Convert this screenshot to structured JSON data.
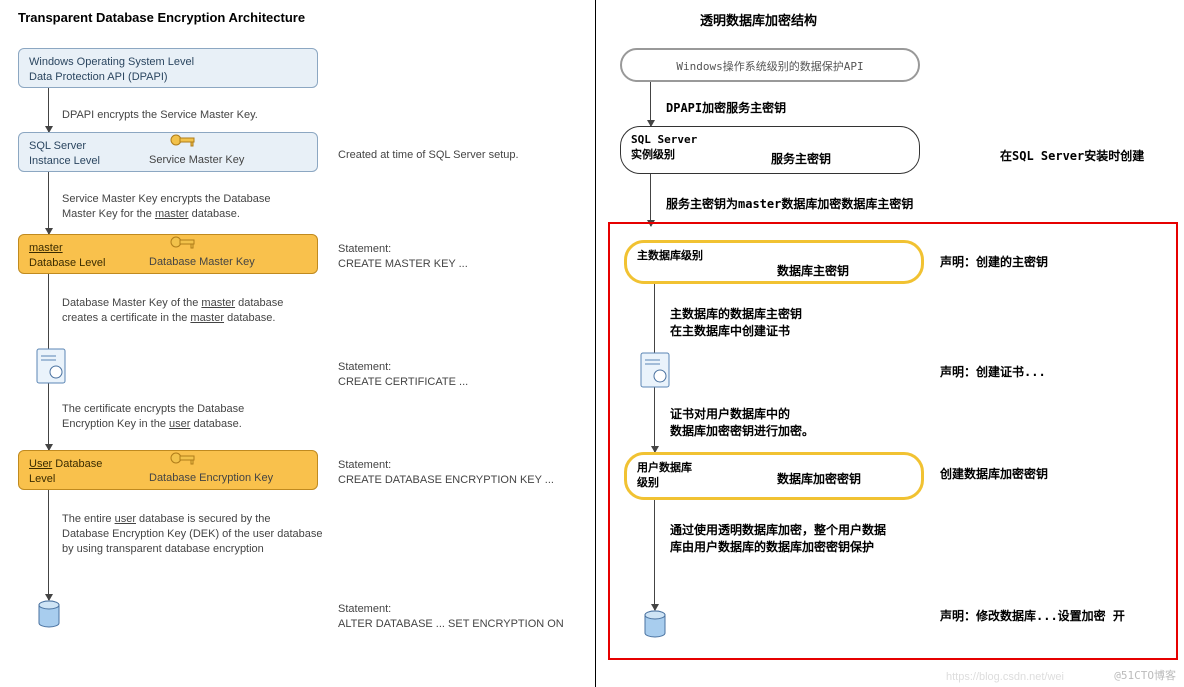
{
  "title_en": "Transparent Database Encryption Architecture",
  "title_zh": "透明数据库加密结构",
  "left": {
    "box1_line1": "Windows Operating System Level",
    "box1_line2": "Data Protection API (DPAPI)",
    "arrow1": "DPAPI encrypts the Service Master Key.",
    "box2_line1": "SQL Server",
    "box2_line2": "Instance Level",
    "box2_key": "Service Master Key",
    "box2_side": "Created at time of SQL Server setup.",
    "arrow2_line1": "Service Master Key encrypts the Database",
    "arrow2_line2": "Master Key for the ",
    "arrow2_u": "master",
    "arrow2_line2b": " database.",
    "box3_u": "master",
    "box3_line2": "Database Level",
    "box3_key": "Database Master Key",
    "box3_side1": "Statement:",
    "box3_side2": "CREATE MASTER KEY ...",
    "arrow3_line1": "Database Master Key of the ",
    "arrow3_u1": "master",
    "arrow3_line1b": " database",
    "arrow3_line2": "creates a certificate in the ",
    "arrow3_u2": "master",
    "arrow3_line2b": " database.",
    "cert_side1": "Statement:",
    "cert_side2": "CREATE CERTIFICATE ...",
    "arrow4_line1": "The certificate encrypts the Database",
    "arrow4_line2": "Encryption Key in the ",
    "arrow4_u": "user",
    "arrow4_line2b": " database.",
    "box4_u": "User",
    "box4_line1b": " Database",
    "box4_line2": "Level",
    "box4_key": "Database Encryption Key",
    "box4_side1": "Statement:",
    "box4_side2": "CREATE DATABASE ENCRYPTION KEY ...",
    "arrow5_line1": "The entire ",
    "arrow5_u": "user",
    "arrow5_line1b": " database is secured by the",
    "arrow5_line2": "Database Encryption Key (DEK) of the user database",
    "arrow5_line3": "by using transparent database encryption",
    "db_side1": "Statement:",
    "db_side2": "ALTER DATABASE ... SET ENCRYPTION ON"
  },
  "right": {
    "box1": "Windows操作系统级别的数据保护API",
    "arrow1": "DPAPI加密服务主密钥",
    "box2_line1": "SQL Server",
    "box2_line2": "实例级别",
    "box2_key": "服务主密钥",
    "box2_side": "在SQL Server安装时创建",
    "arrow2": "服务主密钥为master数据库加密数据库主密钥",
    "box3_line1": "主数据库级别",
    "box3_key": "数据库主密钥",
    "box3_side": "声明：创建的主密钥",
    "arrow3_line1": "主数据库的数据库主密钥",
    "arrow3_line2": "在主数据库中创建证书",
    "cert_side": "声明：创建证书...",
    "arrow4_line1": "证书对用户数据库中的",
    "arrow4_line2": "数据库加密密钥进行加密。",
    "box4_line1": "用户数据库",
    "box4_line2": "级别",
    "box4_key": "数据库加密密钥",
    "box4_side": "创建数据库加密密钥",
    "arrow5_line1": "通过使用透明数据库加密，整个用户数据",
    "arrow5_line2": "库由用户数据库的数据库加密密钥保护",
    "db_side": "声明：修改数据库...设置加密 开"
  },
  "watermark": "@51CTO博客",
  "watermark2": "https://blog.csdn.net/wei"
}
